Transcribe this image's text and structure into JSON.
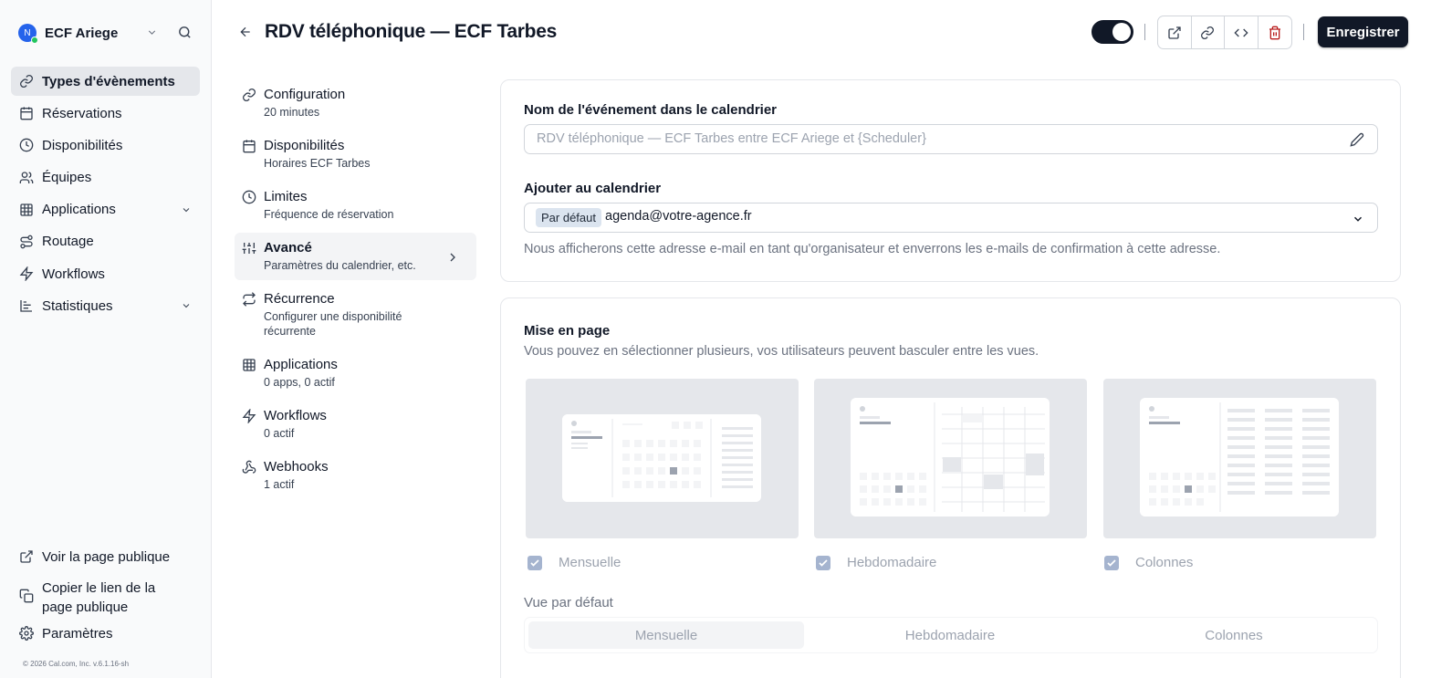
{
  "org": {
    "name": "ECF Ariege",
    "avatar": "N"
  },
  "sidebar": {
    "items": [
      {
        "label": "Types d'évènements",
        "icon": "link-icon"
      },
      {
        "label": "Réservations",
        "icon": "calendar-icon"
      },
      {
        "label": "Disponibilités",
        "icon": "clock-icon"
      },
      {
        "label": "Équipes",
        "icon": "users-icon"
      },
      {
        "label": "Applications",
        "icon": "grid-icon"
      },
      {
        "label": "Routage",
        "icon": "route-icon"
      },
      {
        "label": "Workflows",
        "icon": "zap-icon"
      },
      {
        "label": "Statistiques",
        "icon": "chart-icon"
      }
    ],
    "bottom": {
      "public_page": "Voir la page publique",
      "copy_link": "Copier le lien de la page publique",
      "settings": "Paramètres"
    },
    "copyright": "© 2026 Cal.com, Inc. v.6.1.16-sh"
  },
  "header": {
    "title": "RDV téléphonique — ECF Tarbes",
    "save_label": "Enregistrer",
    "toggle_on": true
  },
  "subnav": [
    {
      "title": "Configuration",
      "desc": "20 minutes"
    },
    {
      "title": "Disponibilités",
      "desc": "Horaires ECF Tarbes"
    },
    {
      "title": "Limites",
      "desc": "Fréquence de réservation"
    },
    {
      "title": "Avancé",
      "desc": "Paramètres du calendrier, etc."
    },
    {
      "title": "Récurrence",
      "desc1": "Configurer une disponibilité",
      "desc2": "récurrente"
    },
    {
      "title": "Applications",
      "desc": "0 apps, 0 actif"
    },
    {
      "title": "Workflows",
      "desc": "0 actif"
    },
    {
      "title": "Webhooks",
      "desc": "1 actif"
    }
  ],
  "calendar": {
    "event_name_label": "Nom de l'événement dans le calendrier",
    "event_name_placeholder": "RDV téléphonique — ECF Tarbes entre ECF Ariege et {Scheduler}",
    "add_to_label": "Ajouter au calendrier",
    "default_badge": "Par défaut",
    "email": "agenda@votre-agence.fr",
    "help": "Nous afficherons cette adresse e-mail en tant qu'organisateur et enverrons les e-mails de confirmation à cette adresse."
  },
  "layout": {
    "title": "Mise en page",
    "subtitle": "Vous pouvez en sélectionner plusieurs, vos utilisateurs peuvent basculer entre les vues.",
    "options": [
      "Mensuelle",
      "Hebdomadaire",
      "Colonnes"
    ],
    "default_view_label": "Vue par défaut",
    "default_view_selected": "Mensuelle"
  }
}
